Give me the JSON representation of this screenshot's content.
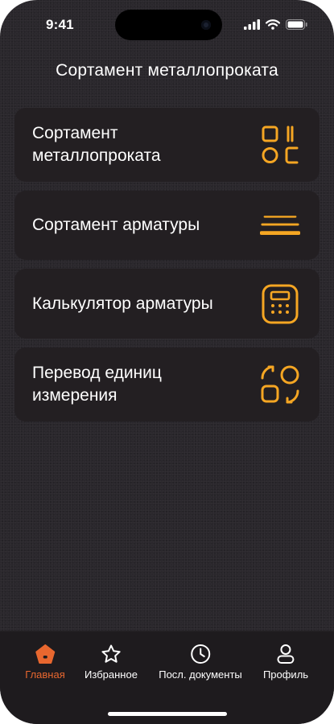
{
  "status_bar": {
    "time": "9:41"
  },
  "header": {
    "title": "Сортамент металлопроката"
  },
  "menu": [
    {
      "label": "Сортамент\nметаллопроката",
      "icon": "grid-shapes-icon"
    },
    {
      "label": "Сортамент арматуры",
      "icon": "rebar-lines-icon"
    },
    {
      "label": "Калькулятор арматуры",
      "icon": "calculator-icon"
    },
    {
      "label": "Перевод единиц\nизмерения",
      "icon": "unit-convert-icon"
    }
  ],
  "tab_bar": {
    "items": [
      {
        "label": "Главная",
        "icon": "home-icon",
        "active": true
      },
      {
        "label": "Избранное",
        "icon": "star-icon",
        "active": false
      },
      {
        "label": "Посл. документы",
        "icon": "clock-icon",
        "active": false
      },
      {
        "label": "Профиль",
        "icon": "user-icon",
        "active": false
      }
    ]
  },
  "colors": {
    "accent": "#f5a623",
    "active_tab": "#e8672f",
    "background": "#2a272c",
    "card": "#231f22"
  }
}
